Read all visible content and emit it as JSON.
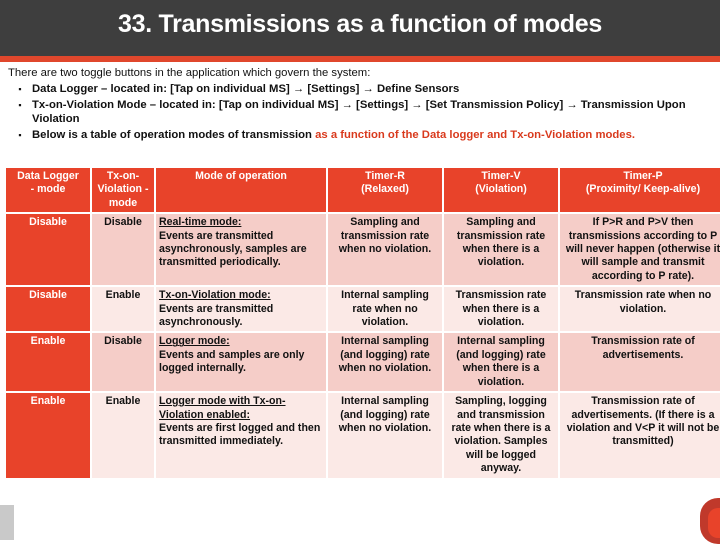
{
  "slide": {
    "title": "33. Transmissions as a function of modes"
  },
  "intro": {
    "lead": "There are two toggle buttons in the application which govern the system:",
    "bullet_mark": "▪",
    "bullets": [
      {
        "text": "Data Logger – located in: [Tap on individual MS] → [Settings] → Define Sensors"
      },
      {
        "text": "Tx-on-Violation Mode – located in: [Tap on individual MS] → [Settings] → [Set Transmission Policy] → Transmission Upon Violation"
      },
      {
        "text": "Below is a table of operation modes of transmission ",
        "accent": "as a function of the Data logger and Tx-on-Violation modes."
      }
    ]
  },
  "table": {
    "headers": [
      "Data Logger - mode",
      "Tx-on-Violation - mode",
      "Mode of operation",
      "Timer-R (Relaxed)",
      "Timer-V (Violation)",
      "Timer-P (Proximity/ Keep-alive)"
    ],
    "header_lines": {
      "h1_l1": "Data Logger",
      "h1_l2": "- mode",
      "h2_l1": "Tx-on-",
      "h2_l2": "Violation -",
      "h2_l3": "mode",
      "h3_l1": "Mode of operation",
      "h4_l1": "Timer-R",
      "h4_l2": "(Relaxed)",
      "h5_l1": "Timer-V",
      "h5_l2": "(Violation)",
      "h6_l1": "Timer-P",
      "h6_l2": "(Proximity/ Keep-alive)"
    },
    "rows": [
      {
        "data_logger": "Disable",
        "tx_on_violation": "Disable",
        "mode_title": "Real-time mode:",
        "mode_body": "Events are transmitted asynchronously, samples are transmitted periodically.",
        "timer_r": "Sampling and transmission rate when no violation.",
        "timer_v": "Sampling and transmission rate when there is a violation.",
        "timer_p": "If P>R and P>V then transmissions according to P will never happen (otherwise it will sample and transmit according to P rate)."
      },
      {
        "data_logger": "Disable",
        "tx_on_violation": "Enable",
        "mode_title": "Tx-on-Violation mode:",
        "mode_body": "Events are transmitted asynchronously.",
        "timer_r": "Internal sampling rate when no violation.",
        "timer_v": "Transmission rate when there is a violation.",
        "timer_p": "Transmission rate when no violation."
      },
      {
        "data_logger": "Enable",
        "tx_on_violation": "Disable",
        "mode_title": "Logger mode:",
        "mode_body": "Events and samples are only logged internally.",
        "timer_r": "Internal sampling (and logging) rate when no violation.",
        "timer_v": "Internal sampling (and logging) rate when there is a violation.",
        "timer_p": "Transmission rate of advertisements."
      },
      {
        "data_logger": "Enable",
        "tx_on_violation": "Enable",
        "mode_title": "Logger mode with Tx-on-Violation enabled:",
        "mode_body": "Events are first logged and then transmitted immediately.",
        "timer_r": "Internal sampling (and logging) rate when no violation.",
        "timer_v": "Sampling, logging and transmission rate when there is a violation. Samples will be logged anyway.",
        "timer_p": "Transmission rate of advertisements. (If there is a violation and V<P it will not be transmitted)"
      }
    ]
  },
  "colors": {
    "title_bar": "#3e3e3e",
    "accent_red": "#e0472c",
    "table_header": "#e8432a",
    "band_a": "#f5cdc8",
    "band_b": "#fbe9e6",
    "text_accent": "#d93a1d"
  }
}
